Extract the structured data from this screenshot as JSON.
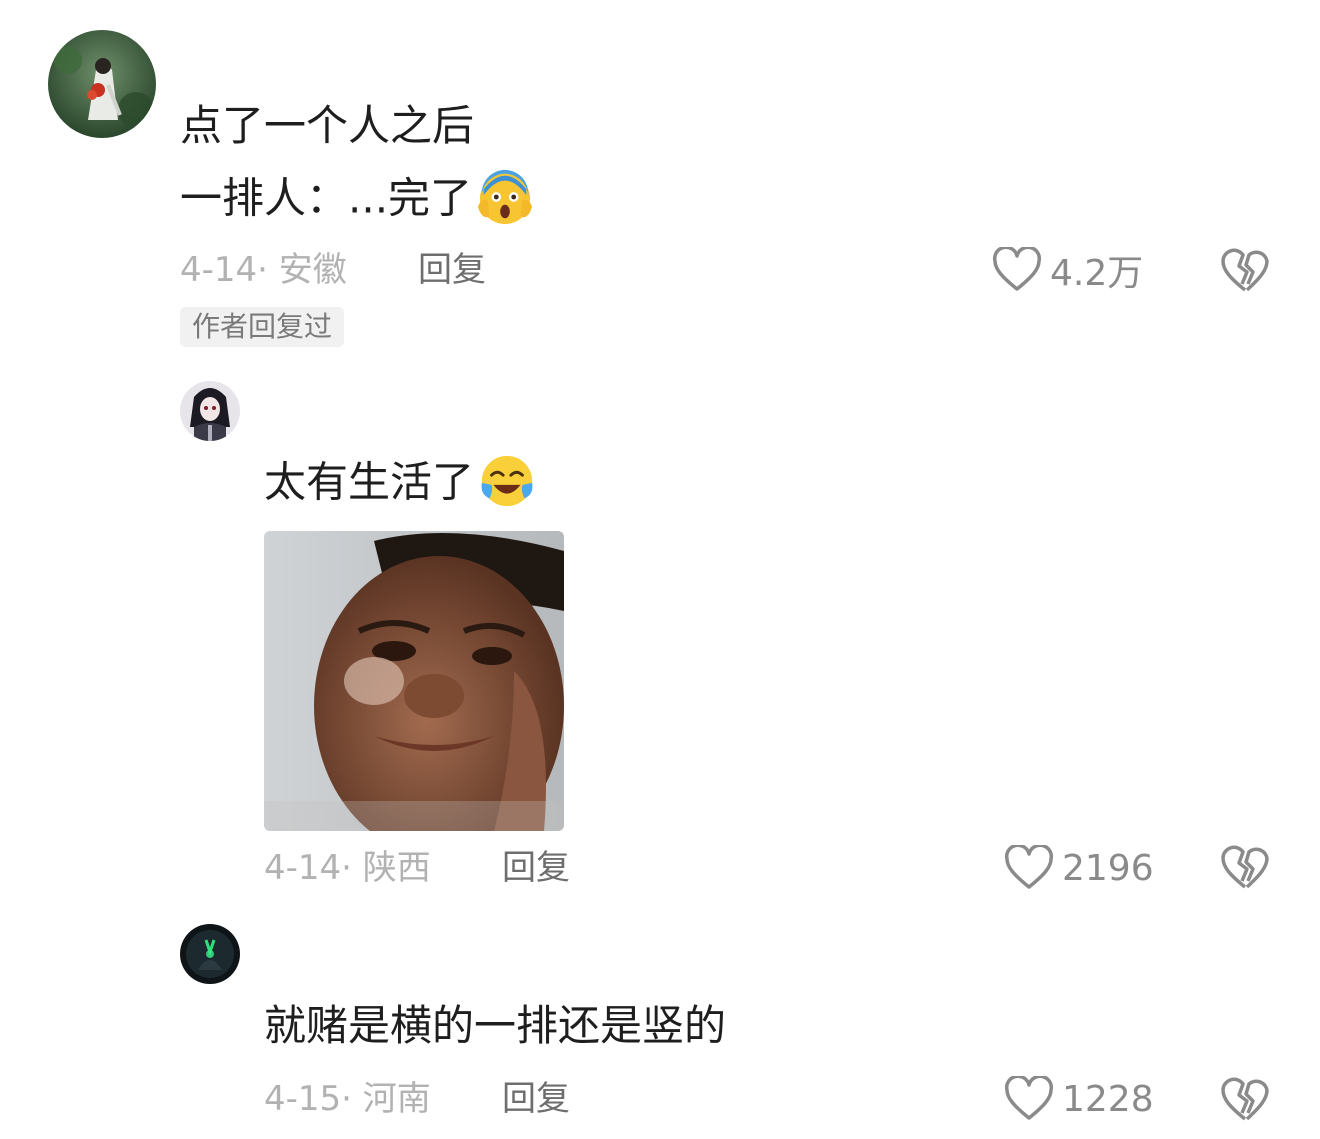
{
  "comments": [
    {
      "text_lines": [
        "点了一个人之后",
        "一排人：...完了"
      ],
      "emoji": "screaming-face",
      "date": "4-14",
      "location": "安徽",
      "reply_label": "回复",
      "likes": "4.2万",
      "author_tag": "作者回复过"
    },
    {
      "text_lines": [
        "太有生活了"
      ],
      "emoji": "crying-laughing-face",
      "has_photo": true,
      "date": "4-14",
      "location": "陕西",
      "reply_label": "回复",
      "likes": "2196"
    },
    {
      "text_lines": [
        "就赌是横的一排还是竖的"
      ],
      "date": "4-15",
      "location": "河南",
      "reply_label": "回复",
      "likes": "1228"
    }
  ],
  "meta_separator": "· ",
  "colors": {
    "text": "#1e1e1e",
    "meta": "#b2b2b2",
    "reply": "#6e6e6e",
    "icon": "#8a8a8a",
    "tag_bg": "#f1f1f1"
  },
  "icons": [
    "heart-icon",
    "broken-heart-icon"
  ]
}
